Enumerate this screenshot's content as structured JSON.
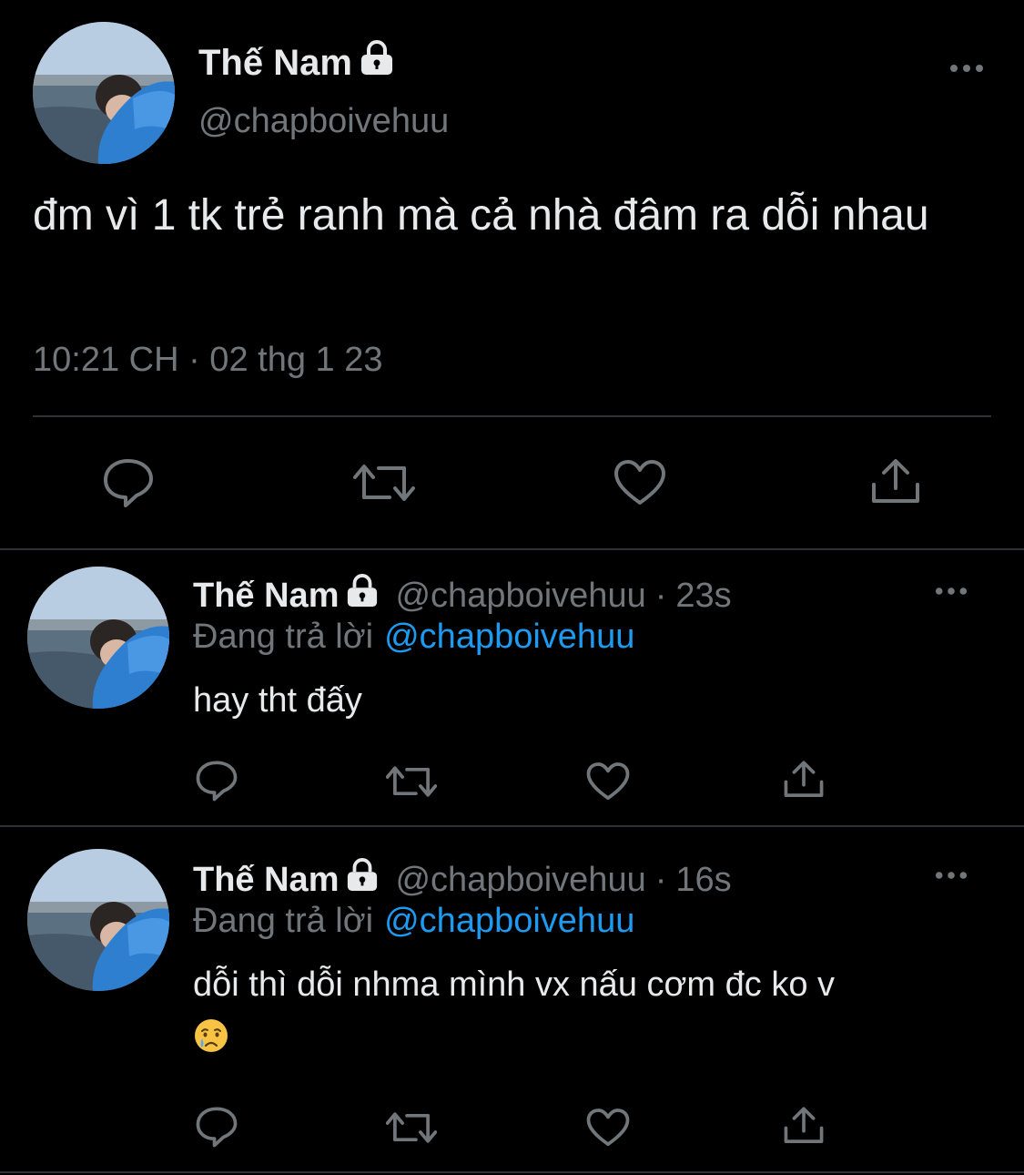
{
  "main_tweet": {
    "author_name": "Thế Nam",
    "author_handle": "@chapboivehuu",
    "text": "đm vì 1 tk trẻ ranh mà cả nhà đâm ra dỗi nhau",
    "timestamp": "10:21 CH · 02 thg 1 23",
    "icons": [
      "reply-icon",
      "retweet-icon",
      "like-icon",
      "share-icon"
    ]
  },
  "replies": [
    {
      "author_name": "Thế Nam",
      "author_handle": "@chapboivehuu",
      "separator": "·",
      "time": "23s",
      "replying_to_label": "Đang trả lời",
      "replying_to_handle": "@chapboivehuu",
      "text": "hay tht đấy"
    },
    {
      "author_name": "Thế Nam",
      "author_handle": "@chapboivehuu",
      "separator": "·",
      "time": "16s",
      "replying_to_label": "Đang trả lời",
      "replying_to_handle": "@chapboivehuu",
      "text": "dỗi thì dỗi nhma mình vx nấu cơm đc ko v",
      "emoji": "crying-face-icon"
    }
  ],
  "colors": {
    "background": "#000000",
    "text_primary": "#e7e9ea",
    "text_secondary": "#71767b",
    "accent": "#1d9bf0",
    "divider": "#2f3336"
  }
}
